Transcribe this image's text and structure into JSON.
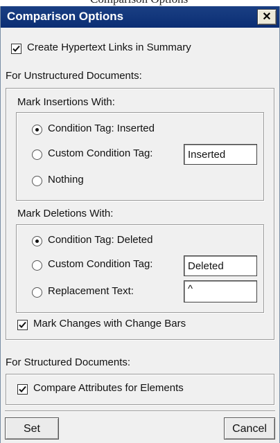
{
  "window": {
    "overflow_title": "Comparison Options",
    "title": "Comparison Options",
    "close_label": "✕"
  },
  "options": {
    "hypertext_links": {
      "label": "Create Hypertext Links in Summary",
      "checked": true
    },
    "unstructured_heading": "For Unstructured Documents:",
    "insertions": {
      "heading": "Mark Insertions With:",
      "choices": [
        {
          "label": "Condition Tag: Inserted",
          "selected": true
        },
        {
          "label": "Custom Condition Tag:",
          "selected": false,
          "value": "Inserted"
        },
        {
          "label": "Nothing",
          "selected": false
        }
      ]
    },
    "deletions": {
      "heading": "Mark Deletions With:",
      "choices": [
        {
          "label": "Condition Tag: Deleted",
          "selected": true
        },
        {
          "label": "Custom Condition Tag:",
          "selected": false,
          "value": "Deleted"
        },
        {
          "label": "Replacement Text:",
          "selected": false,
          "value": "^"
        }
      ]
    },
    "change_bars": {
      "label": "Mark Changes with Change Bars",
      "checked": true
    },
    "structured_heading": "For Structured Documents:",
    "compare_attributes": {
      "label": "Compare Attributes for Elements",
      "checked": true
    }
  },
  "buttons": {
    "set": "Set",
    "cancel": "Cancel"
  }
}
